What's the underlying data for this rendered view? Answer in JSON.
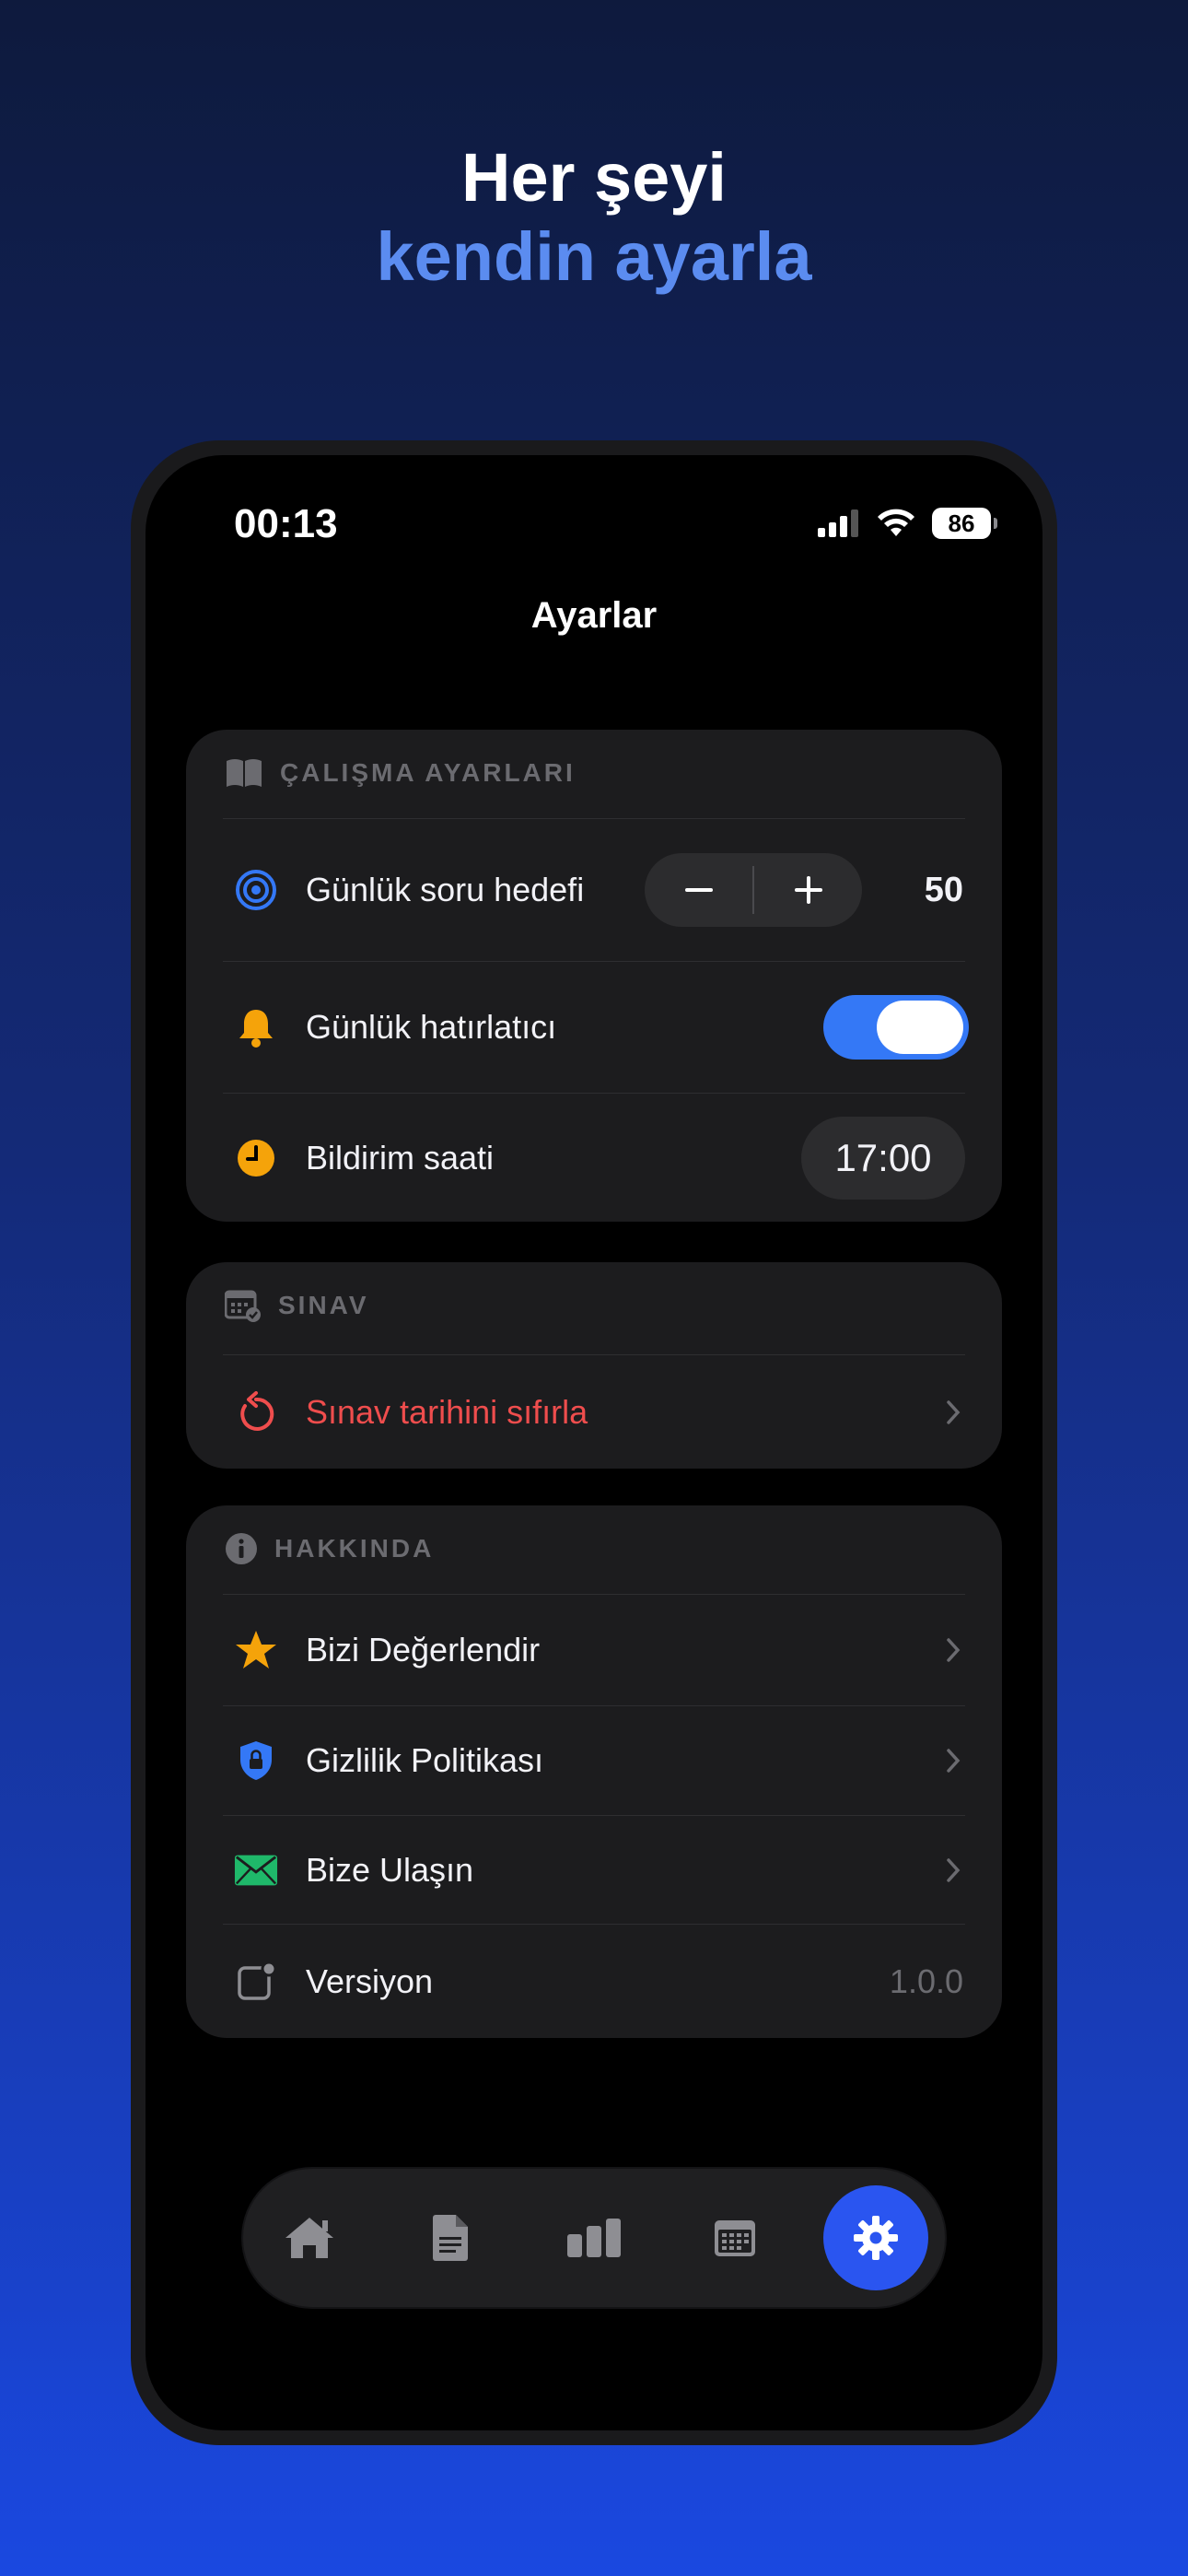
{
  "hero": {
    "line1": "Her şeyi",
    "line2": "kendin ayarla"
  },
  "status": {
    "time": "00:13",
    "battery": "86"
  },
  "nav": {
    "title": "Ayarlar"
  },
  "colors": {
    "accent": "#3478f6",
    "danger": "#ef4d4d",
    "warning": "#f5a30a",
    "success": "#1fb86a",
    "tab_active": "#2a55f0"
  },
  "sections": {
    "study": {
      "header": "ÇALIŞMA AYARLARI",
      "header_icon": "book-icon",
      "goal": {
        "label": "Günlük soru hedefi",
        "icon": "target-icon",
        "value": "50"
      },
      "reminder": {
        "label": "Günlük hatırlatıcı",
        "icon": "bell-icon",
        "enabled": true
      },
      "time": {
        "label": "Bildirim saati",
        "icon": "clock-icon",
        "value": "17:00"
      }
    },
    "exam": {
      "header": "SINAV",
      "header_icon": "calendar-check-icon",
      "reset": {
        "label": "Sınav tarihini sıfırla",
        "icon": "reset-icon"
      }
    },
    "about": {
      "header": "HAKKINDA",
      "header_icon": "info-icon",
      "rate": {
        "label": "Bizi Değerlendir",
        "icon": "star-icon"
      },
      "privacy": {
        "label": "Gizlilik Politikası",
        "icon": "shield-lock-icon"
      },
      "contact": {
        "label": "Bize Ulaşın",
        "icon": "envelope-icon"
      },
      "version": {
        "label": "Versiyon",
        "icon": "app-badge-icon",
        "value": "1.0.0"
      }
    }
  },
  "tabbar": {
    "items": [
      {
        "icon": "home-icon",
        "active": false
      },
      {
        "icon": "document-icon",
        "active": false
      },
      {
        "icon": "bar-chart-icon",
        "active": false
      },
      {
        "icon": "calendar-icon",
        "active": false
      },
      {
        "icon": "gear-icon",
        "active": true
      }
    ]
  }
}
